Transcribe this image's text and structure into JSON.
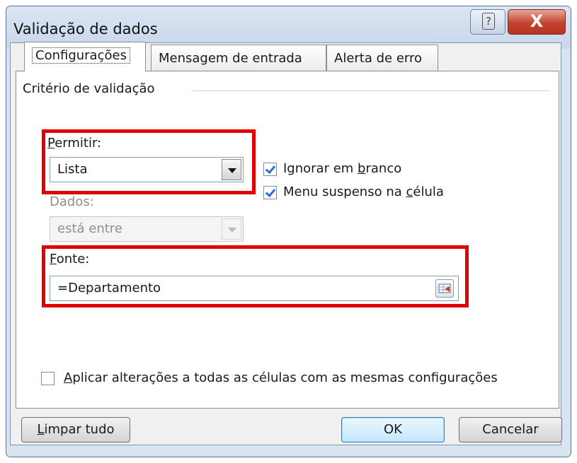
{
  "window": {
    "title": "Validação de dados",
    "help_icon": "?",
    "close_icon": "X"
  },
  "tabs": [
    {
      "label": "Configurações"
    },
    {
      "label": "Mensagem de entrada"
    },
    {
      "label": "Alerta de erro"
    }
  ],
  "criteria": {
    "group_title": "Critério de validação",
    "allow": {
      "label_first": "P",
      "label_rest": "ermitir:",
      "value": "Lista"
    },
    "data": {
      "label": "Dados:",
      "value": "está entre"
    },
    "ignore_blank": {
      "before": "Ignorar em ",
      "accel": "b",
      "after": "ranco",
      "checked": true
    },
    "in_cell_dropdown": {
      "before": "Menu suspenso na ",
      "accel": "c",
      "after": "élula",
      "checked": true
    },
    "source": {
      "label_first": "F",
      "label_rest": "onte:",
      "value": "=Departamento"
    }
  },
  "apply_all": {
    "first": "A",
    "rest": "plicar alterações a todas as células com as mesmas configurações",
    "checked": false
  },
  "buttons": {
    "clear_first": "L",
    "clear_rest": "impar tudo",
    "ok": "OK",
    "cancel": "Cancelar"
  },
  "colors": {
    "highlight": "#e00000",
    "checkmark": "#2a6fd6"
  }
}
